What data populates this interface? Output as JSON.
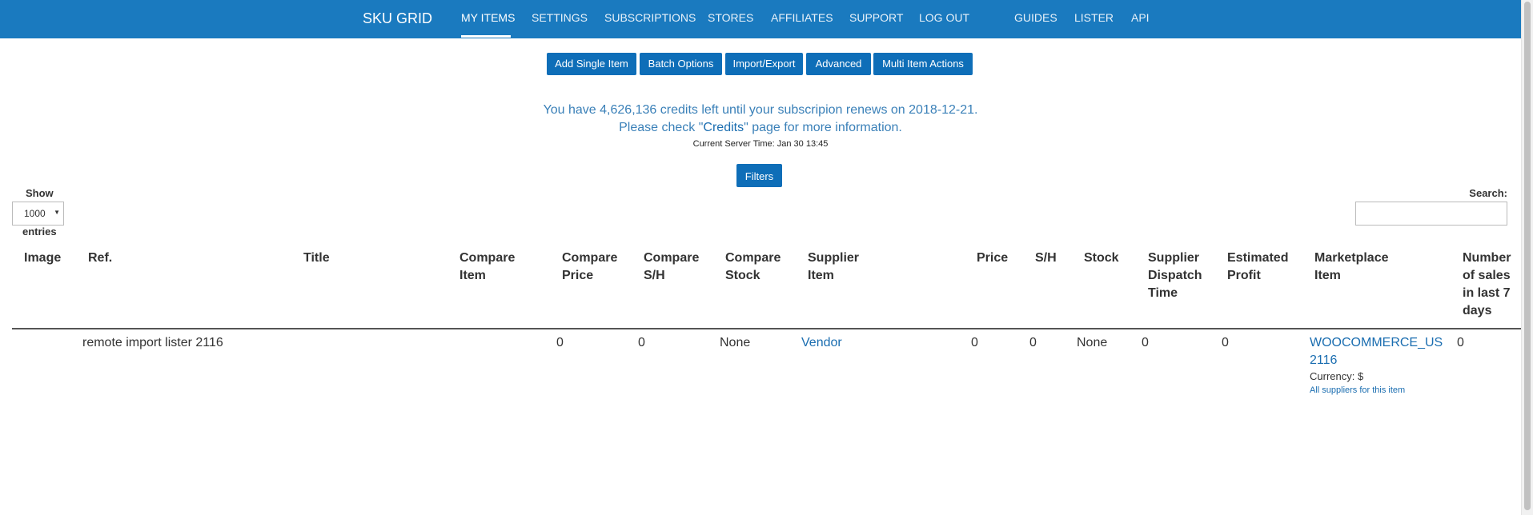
{
  "brand": "SKU GRID",
  "nav": {
    "items": [
      {
        "label": "MY ITEMS",
        "active": true
      },
      {
        "label": "SETTINGS"
      },
      {
        "label": "SUBSCRIPTIONS"
      },
      {
        "label": "STORES"
      },
      {
        "label": "AFFILIATES"
      },
      {
        "label": "SUPPORT"
      },
      {
        "label": "LOG OUT"
      },
      {
        "label": "GUIDES"
      },
      {
        "label": "LISTER"
      },
      {
        "label": "API"
      }
    ]
  },
  "actions": [
    "Add Single Item",
    "Batch Options",
    "Import/Export",
    "Advanced",
    "Multi Item Actions"
  ],
  "credits": {
    "line1": "You have 4,626,136 credits left until your subscripion renews on 2018-12-21.",
    "line2_before": "Please check \"",
    "line2_link": "Credits",
    "line2_after": "\" page for more information."
  },
  "server_time": "Current Server Time: Jan 30 13:45",
  "filters_label": "Filters",
  "show": {
    "label": "Show",
    "value": "1000",
    "entries_label": "entries"
  },
  "search": {
    "label": "Search:",
    "value": ""
  },
  "table": {
    "columns": [
      [
        "Image"
      ],
      [
        "Ref."
      ],
      [
        "Title"
      ],
      [
        "Compare",
        "Item"
      ],
      [
        "Compare",
        "Price"
      ],
      [
        "Compare",
        "S/H"
      ],
      [
        "Compare",
        "Stock"
      ],
      [
        "Supplier",
        "Item"
      ],
      [
        "Price"
      ],
      [
        "S/H"
      ],
      [
        "Stock"
      ],
      [
        "Supplier",
        "Dispatch",
        "Time"
      ],
      [
        "Estimated",
        "Profit"
      ],
      [
        "Marketplace",
        "Item"
      ],
      [
        "Number",
        "of sales",
        "in last 7",
        "days"
      ]
    ],
    "row": {
      "ref": "remote import lister 2116",
      "compare_price": "0",
      "compare_sh": "0",
      "compare_stock": "None",
      "supplier_item": "Vendor",
      "price": "0",
      "sh": "0",
      "stock": "None",
      "dispatch_time": "0",
      "estimated_profit": "0",
      "marketplace_line1": "WOOCOMMERCE_US",
      "marketplace_line2": "2116",
      "currency": "Currency: $",
      "all_suppliers": "All suppliers for this item",
      "sales_7_days": "0"
    }
  },
  "colors": {
    "topbar": "#1a7abf",
    "button": "#0e6eb8",
    "link": "#1a6db0"
  }
}
